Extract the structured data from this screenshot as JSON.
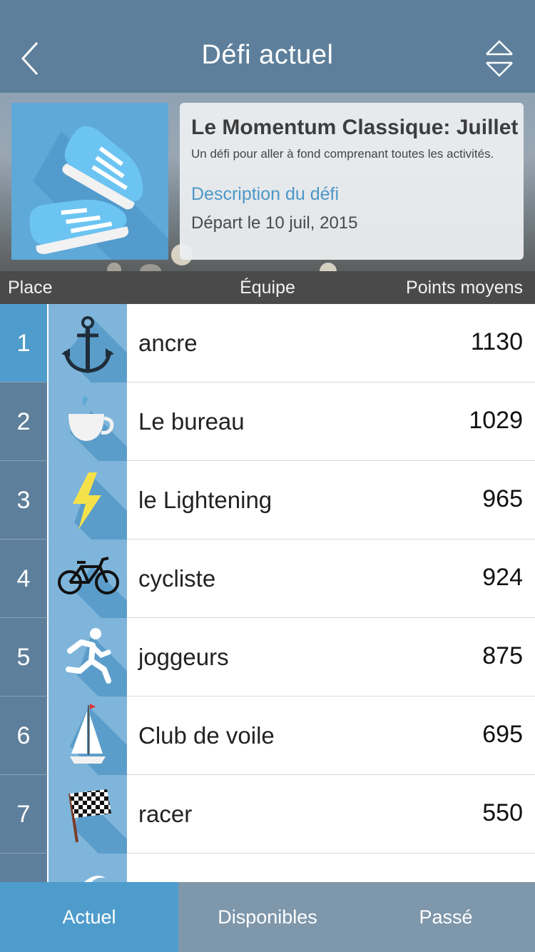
{
  "header": {
    "title": "Défi actuel"
  },
  "challenge": {
    "title": "Le Momentum Classique: Juillet",
    "subtitle": "Un défi pour aller à fond comprenant toutes les activités.",
    "link_label": "Description du défi",
    "start_date": "Départ le 10 juil, 2015"
  },
  "columns": {
    "place": "Place",
    "team": "Équipe",
    "points": "Points moyens"
  },
  "teams": [
    {
      "rank": "1",
      "name": "ancre",
      "points": "1130",
      "icon": "anchor-icon"
    },
    {
      "rank": "2",
      "name": "Le bureau",
      "points": "1029",
      "icon": "coffee-cup-icon"
    },
    {
      "rank": "3",
      "name": "le Lightening",
      "points": "965",
      "icon": "lightning-bolt-icon"
    },
    {
      "rank": "4",
      "name": "cycliste",
      "points": "924",
      "icon": "bicycle-icon"
    },
    {
      "rank": "5",
      "name": "joggeurs",
      "points": "875",
      "icon": "runner-icon"
    },
    {
      "rank": "6",
      "name": "Club de voile",
      "points": "695",
      "icon": "sailboat-icon"
    },
    {
      "rank": "7",
      "name": "racer",
      "points": "550",
      "icon": "checkered-flag-icon"
    },
    {
      "rank": "",
      "name": "",
      "points": "",
      "icon": "moon-icon"
    }
  ],
  "tabs": [
    {
      "label": "Actuel",
      "active": true
    },
    {
      "label": "Disponibles",
      "active": false
    },
    {
      "label": "Passé",
      "active": false
    }
  ],
  "colors": {
    "header": "#5d7f9b",
    "accent": "#4e9ccc",
    "tab_inactive": "#7f97ab",
    "column_header": "#4a4a4a"
  }
}
